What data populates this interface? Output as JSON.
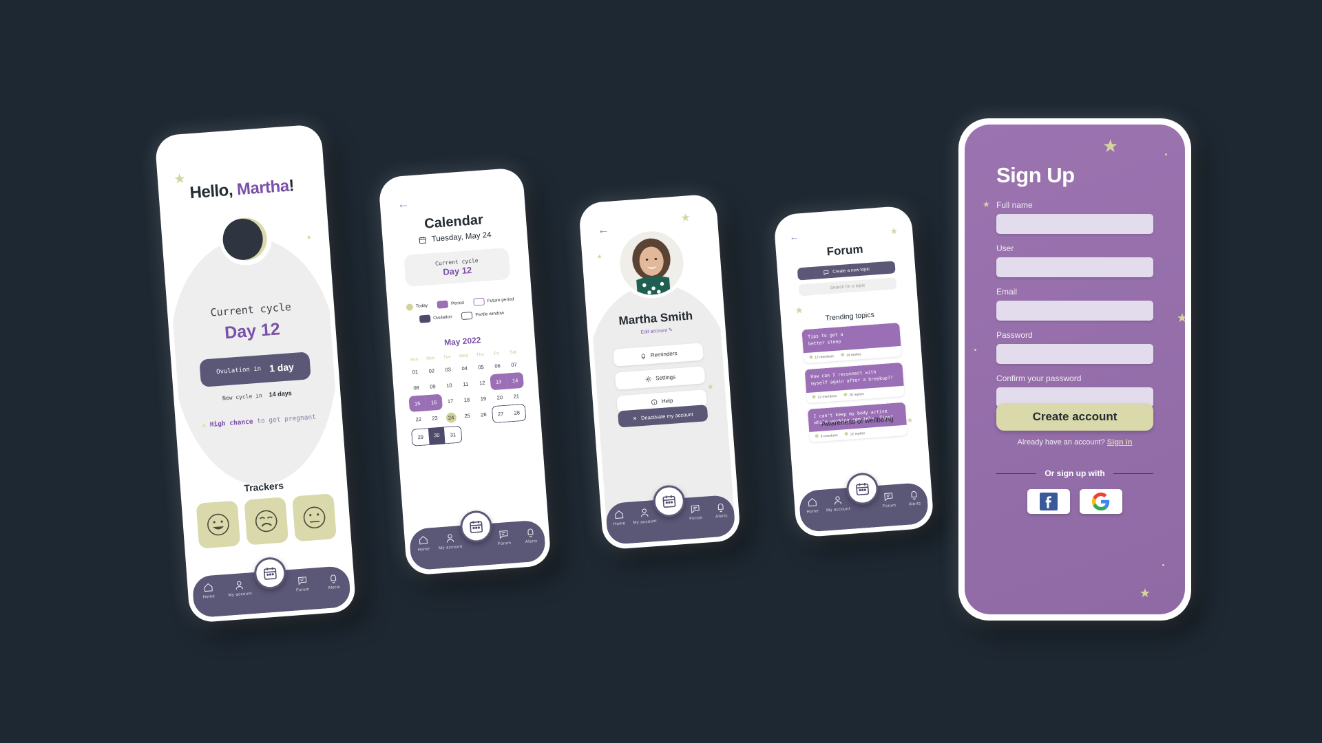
{
  "background_color": "#1e2832",
  "accent_purple": "#7a51a8",
  "accent_olive": "#d9d9ab",
  "accent_slate": "#5b5777",
  "nav": {
    "items": [
      {
        "label": "Home",
        "icon": "home-icon"
      },
      {
        "label": "My account",
        "icon": "user-icon"
      },
      {
        "label": "Forum",
        "icon": "chat-icon"
      },
      {
        "label": "Alerts",
        "icon": "bell-icon"
      }
    ],
    "center_icon": "calendar-icon"
  },
  "home": {
    "greeting_prefix": "Hello, ",
    "greeting_name": "Martha",
    "greeting_suffix": "!",
    "moon_icon": "moon-phase-icon",
    "cycle_label": "Current cycle",
    "cycle_day": "Day 12",
    "ovulation_label": "Ovulation in",
    "ovulation_value": "1 day",
    "newcycle_label": "New cycle in",
    "newcycle_value": "14 days",
    "warning_icon": "warning-icon",
    "chance_strong": "High chance",
    "chance_rest": " to get pregnant",
    "trackers_title": "Trackers",
    "trackers": [
      {
        "name": "happy-face-tracker"
      },
      {
        "name": "sad-face-tracker"
      },
      {
        "name": "neutral-face-tracker"
      }
    ]
  },
  "calendar": {
    "back_icon": "back-arrow-icon",
    "title": "Calendar",
    "date_icon": "calendar-icon",
    "date": "Tuesday, May 24",
    "cycle_label": "Current cycle",
    "cycle_day": "Day 12",
    "legend": [
      {
        "label": "Today",
        "swatch": "circle"
      },
      {
        "label": "Period",
        "swatch": "period"
      },
      {
        "label": "Future period",
        "swatch": "futper"
      },
      {
        "label": "Ovulation",
        "swatch": "ovul"
      },
      {
        "label": "Fertile window",
        "swatch": "fert"
      }
    ],
    "month": "May 2022",
    "weekdays": [
      "Sun",
      "Mon",
      "Tue",
      "Wed",
      "Thu",
      "Fri",
      "Sat"
    ],
    "weeks": [
      [
        {
          "d": "01"
        },
        {
          "d": "02"
        },
        {
          "d": "03"
        },
        {
          "d": "04"
        },
        {
          "d": "05"
        },
        {
          "d": "06"
        },
        {
          "d": "07"
        }
      ],
      [
        {
          "d": "08"
        },
        {
          "d": "09"
        },
        {
          "d": "10"
        },
        {
          "d": "11"
        },
        {
          "d": "12"
        },
        {
          "d": "13",
          "s": "period r-start"
        },
        {
          "d": "14",
          "s": "period r-end"
        }
      ],
      [
        {
          "d": "15",
          "s": "period r-start"
        },
        {
          "d": "16",
          "s": "period r-end"
        },
        {
          "d": "17"
        },
        {
          "d": "18"
        },
        {
          "d": "19"
        },
        {
          "d": "20"
        },
        {
          "d": "21"
        }
      ],
      [
        {
          "d": "22"
        },
        {
          "d": "23"
        },
        {
          "d": "24",
          "s": "today"
        },
        {
          "d": "25"
        },
        {
          "d": "26"
        },
        {
          "d": "27",
          "s": "fert f-start"
        },
        {
          "d": "28",
          "s": "fert f-end"
        }
      ],
      [
        {
          "d": "29",
          "s": "fert f-start"
        },
        {
          "d": "30",
          "s": "ovul"
        },
        {
          "d": "31",
          "s": "fert f-end"
        },
        {
          "d": ""
        },
        {
          "d": ""
        },
        {
          "d": ""
        },
        {
          "d": ""
        }
      ]
    ]
  },
  "profile": {
    "back_icon": "back-arrow-icon",
    "avatar": "user-photo-avatar",
    "name": "Martha Smith",
    "edit_label": "Edit account",
    "edit_icon": "pencil-icon",
    "buttons": [
      {
        "label": "Reminders",
        "icon": "bell-icon"
      },
      {
        "label": "Settings",
        "icon": "gear-icon"
      },
      {
        "label": "Help",
        "icon": "info-icon"
      }
    ],
    "deactivate_label": "Deactivate my account",
    "deactivate_icon": "close-icon"
  },
  "forum": {
    "back_icon": "back-arrow-icon",
    "title": "Forum",
    "new_topic_label": "Create a new topic",
    "new_topic_icon": "chat-icon",
    "search_placeholder": "Search for a topic",
    "trending_title": "Trending topics",
    "topics": [
      {
        "title": "Tips to get a\nbetter sleep",
        "members": "17 members",
        "replies": "14 replies"
      },
      {
        "title": "How can I reconnect with\nmyself again after a breakup??",
        "members": "22 members",
        "replies": "28 replies"
      },
      {
        "title": "I can't keep my body active\nwhile working remotely. Tips?",
        "members": "9 members",
        "replies": "12 replies"
      }
    ],
    "awareness_title": "Awareness of wellbeing"
  },
  "signup": {
    "title": "Sign Up",
    "fields": [
      {
        "label": "Full name",
        "value": "",
        "placeholder": ""
      },
      {
        "label": "User",
        "value": "",
        "placeholder": ""
      },
      {
        "label": "Email",
        "value": "",
        "placeholder": ""
      },
      {
        "label": "Password",
        "value": "",
        "placeholder": ""
      },
      {
        "label": "Confirm your password",
        "value": "",
        "placeholder": ""
      }
    ],
    "create_label": "Create account",
    "have_account": "Already have an account? ",
    "signin_label": "Sign in",
    "or_label": "Or sign up with",
    "socials": [
      {
        "name": "facebook-icon"
      },
      {
        "name": "google-icon"
      }
    ]
  }
}
